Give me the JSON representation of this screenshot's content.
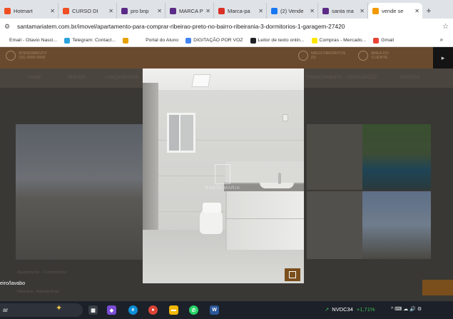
{
  "browser": {
    "tabs": [
      {
        "title": "Hotmart",
        "favicon_color": "#f04e23",
        "favicon": "fire-icon",
        "active": false
      },
      {
        "title": "CURSO DI",
        "favicon_color": "#f04e23",
        "favicon": "fire-icon",
        "active": false
      },
      {
        "title": "pro bnp",
        "favicon_color": "#5b2a86",
        "favicon": "w-icon",
        "active": false
      },
      {
        "title": "MARCA P",
        "favicon_color": "#5b2a86",
        "favicon": "w-icon",
        "active": false
      },
      {
        "title": "Marca-pa",
        "favicon_color": "#d93025",
        "favicon": "cross-icon",
        "active": false
      },
      {
        "title": "(2) Vende",
        "favicon_color": "#1877f2",
        "favicon": "facebook-icon",
        "active": false
      },
      {
        "title": "santa ma",
        "favicon_color": "#5b2a86",
        "favicon": "w-icon",
        "active": false
      },
      {
        "title": "vende se",
        "favicon_color": "#f29900",
        "favicon": "building-icon",
        "active": true
      }
    ],
    "new_tab_label": "+",
    "close_glyph": "✕",
    "url": "santamariatem.com.br/imovel/apartamento-para-comprar-ribeirao-preto-no-bairro-ribeirania-3-dormitorios-1-garagem-27420",
    "bookmarks": [
      {
        "label": "Email - Otavio Nasci...",
        "icon_color": "#ffffff"
      },
      {
        "label": "Telegram: Contact...",
        "icon_color": "#2aa3de"
      },
      {
        "label": "",
        "icon_color": "#e8a100"
      },
      {
        "label": "Portal do Aluno",
        "icon_color": "#ffffff"
      },
      {
        "label": "DIGITAÇÃO POR VOZ",
        "icon_color": "#4285f4"
      },
      {
        "label": "Leitor de texto onlin...",
        "icon_color": "#202124"
      },
      {
        "label": "Compras - Mercado...",
        "icon_color": "#ffe600"
      },
      {
        "label": "Gmail",
        "icon_color": "#ea4335"
      }
    ],
    "bookmarks_more": "»"
  },
  "site": {
    "header_left_line1": "ATENDIMENTO",
    "header_left_line2": "(16) 3000-0000",
    "header_right_1_line1": "MEUS FAVORITOS",
    "header_right_1_line2": "(0)",
    "header_right_2_line1": "ÁREA DO",
    "header_right_2_line2": "CLIENTE",
    "arrow_label": "▸",
    "nav": [
      "HOME",
      "IMÓVEIS",
      "LANÇAMENTOS",
      "FINANCIAMENTO",
      "LOCALIZAÇÃO",
      "CONTATO"
    ],
    "thumb_label": "Apartamento · 3 Dormitórios",
    "caption": "eiro/lavabo",
    "subcaption": "Ribeirânia · Ribeirão Preto"
  },
  "lightbox": {
    "watermark": "SANTA MARIA"
  },
  "taskbar": {
    "search_text": "ar",
    "stock_symbol": "NVDC34",
    "stock_change": "+1,71%",
    "tray_text": "^ ⌨ ☁ 🔊 ⚙"
  }
}
